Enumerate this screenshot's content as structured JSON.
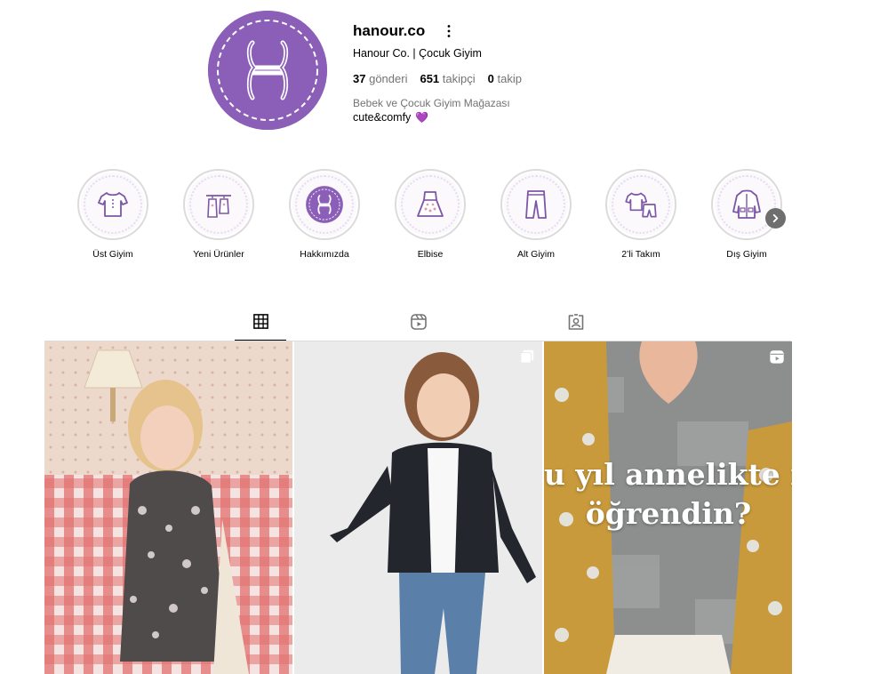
{
  "profile": {
    "username": "hanour.co",
    "full_name": "Hanour Co. | Çocuk Giyim",
    "stats": [
      {
        "value": "37",
        "label": "gönderi"
      },
      {
        "value": "651",
        "label": "takipçi"
      },
      {
        "value": "0",
        "label": "takip"
      }
    ],
    "bio_line1": "Bebek ve Çocuk Giyim Mağazası",
    "bio_line2": "cute&comfy",
    "bio_emoji": "💜",
    "brand_color": "#8b5fb8"
  },
  "highlights": [
    {
      "label": "Üst Giyim",
      "icon": "tshirt-icon"
    },
    {
      "label": "Yeni Ürünler",
      "icon": "hanging-clothes-icon"
    },
    {
      "label": "Hakkımızda",
      "icon": "brand-logo-icon"
    },
    {
      "label": "Elbise",
      "icon": "dress-icon"
    },
    {
      "label": "Alt Giyim",
      "icon": "pants-icon"
    },
    {
      "label": "2’li Takım",
      "icon": "two-piece-set-icon"
    },
    {
      "label": "Dış Giyim",
      "icon": "coat-icon"
    }
  ],
  "tabs": [
    {
      "name": "posts",
      "icon": "grid-icon",
      "active": true
    },
    {
      "name": "reels",
      "icon": "reels-icon",
      "active": false
    },
    {
      "name": "tagged",
      "icon": "tagged-icon",
      "active": false
    }
  ],
  "posts": [
    {
      "badge": "",
      "description_color": "#e9d4c4"
    },
    {
      "badge": "carousel-icon",
      "description_color": "#ebebeb"
    },
    {
      "badge": "reels-icon",
      "overlay_line1": "u yıl annelikte n",
      "overlay_line2": "öğrendin?"
    }
  ]
}
